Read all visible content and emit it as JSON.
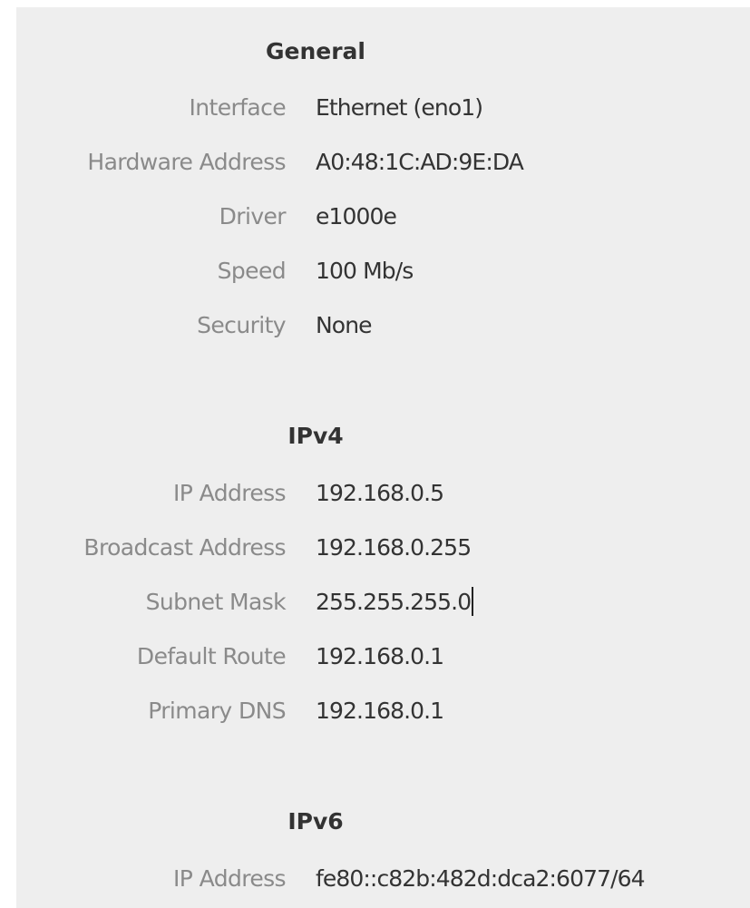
{
  "general": {
    "title": "General",
    "rows": [
      {
        "label": "Interface",
        "value": "Ethernet (eno1)"
      },
      {
        "label": "Hardware Address",
        "value": "A0:48:1C:AD:9E:DA"
      },
      {
        "label": "Driver",
        "value": "e1000e"
      },
      {
        "label": "Speed",
        "value": "100 Mb/s"
      },
      {
        "label": "Security",
        "value": "None"
      }
    ]
  },
  "ipv4": {
    "title": "IPv4",
    "rows": [
      {
        "label": "IP Address",
        "value": "192.168.0.5"
      },
      {
        "label": "Broadcast Address",
        "value": "192.168.0.255"
      },
      {
        "label": "Subnet Mask",
        "value": "255.255.255.0"
      },
      {
        "label": "Default Route",
        "value": "192.168.0.1"
      },
      {
        "label": "Primary DNS",
        "value": "192.168.0.1"
      }
    ]
  },
  "ipv6": {
    "title": "IPv6",
    "rows": [
      {
        "label": "IP Address",
        "value": "fe80::c82b:482d:dca2:6077/64"
      }
    ]
  }
}
